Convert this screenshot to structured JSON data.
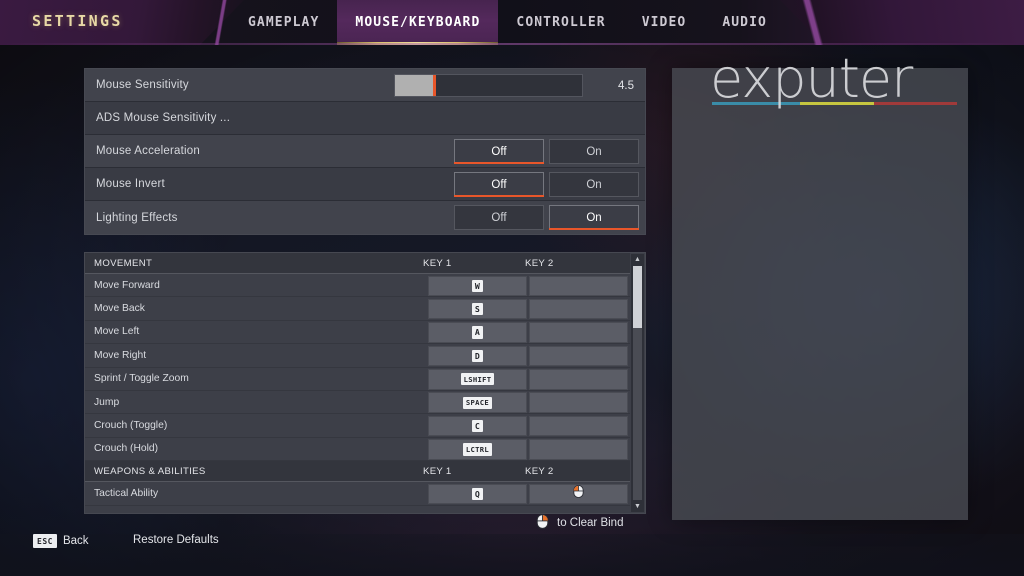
{
  "header": {
    "title": "SETTINGS",
    "tabs": [
      {
        "label": "GAMEPLAY",
        "active": false
      },
      {
        "label": "MOUSE/KEYBOARD",
        "active": true
      },
      {
        "label": "CONTROLLER",
        "active": false
      },
      {
        "label": "VIDEO",
        "active": false
      },
      {
        "label": "AUDIO",
        "active": false
      }
    ]
  },
  "basic_settings": [
    {
      "label": "Mouse Sensitivity",
      "type": "slider",
      "value": "4.5",
      "fill_percent": 22
    },
    {
      "label": "ADS Mouse Sensitivity ...",
      "type": "submenu"
    },
    {
      "label": "Mouse Acceleration",
      "type": "toggle",
      "options": [
        "Off",
        "On"
      ],
      "selected": "Off"
    },
    {
      "label": "Mouse Invert",
      "type": "toggle",
      "options": [
        "Off",
        "On"
      ],
      "selected": "Off"
    },
    {
      "label": "Lighting Effects",
      "type": "toggle",
      "options": [
        "Off",
        "On"
      ],
      "selected": "On"
    }
  ],
  "keybinds": {
    "column_headers": {
      "key1": "KEY 1",
      "key2": "KEY 2"
    },
    "sections": [
      {
        "title": "MOVEMENT",
        "rows": [
          {
            "action": "Move Forward",
            "key1": "W",
            "key2": ""
          },
          {
            "action": "Move Back",
            "key1": "S",
            "key2": ""
          },
          {
            "action": "Move Left",
            "key1": "A",
            "key2": ""
          },
          {
            "action": "Move Right",
            "key1": "D",
            "key2": ""
          },
          {
            "action": "Sprint / Toggle Zoom",
            "key1": "LSHIFT",
            "key2": ""
          },
          {
            "action": "Jump",
            "key1": "SPACE",
            "key2": ""
          },
          {
            "action": "Crouch (Toggle)",
            "key1": "C",
            "key2": ""
          },
          {
            "action": "Crouch (Hold)",
            "key1": "LCTRL",
            "key2": ""
          }
        ]
      },
      {
        "title": "WEAPONS & ABILITIES",
        "rows": [
          {
            "action": "Tactical Ability",
            "key1": "Q",
            "key2": "mouse-left-icon"
          }
        ]
      }
    ],
    "scrollbar": {
      "up_arrow": "▲",
      "down_arrow": "▼"
    }
  },
  "hints": {
    "clear_bind_icon": "mouse-right-icon",
    "clear_bind_text": "to Clear Bind"
  },
  "footer": {
    "back_key": "ESC",
    "back_label": "Back",
    "restore_label": "Restore Defaults"
  },
  "watermark": {
    "text": "exputer",
    "bar_colors": [
      "#3a8ca8",
      "#c6c640",
      "#a03a3a"
    ]
  },
  "colors": {
    "accent_orange": "#e8562a",
    "accent_gold": "#e8d9a6",
    "tab_active_purple": "#4f2757",
    "panel_gray": "#41434c"
  }
}
